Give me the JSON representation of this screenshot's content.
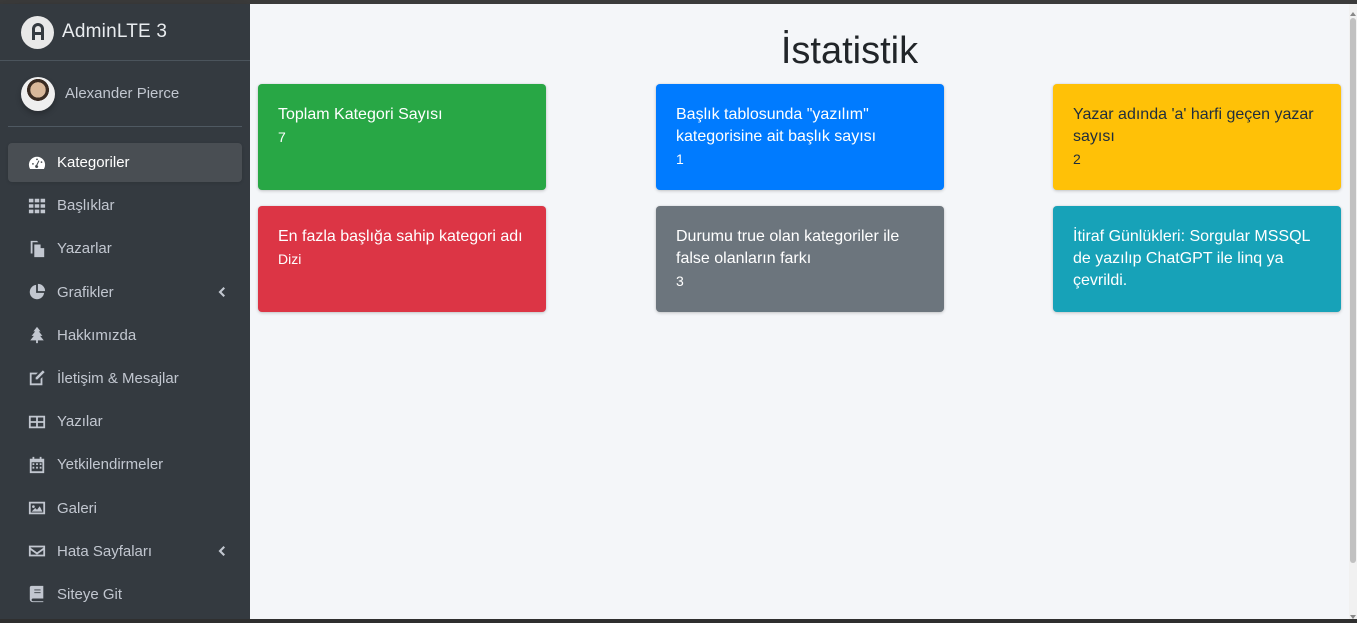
{
  "brand": {
    "name": "AdminLTE 3"
  },
  "user": {
    "name": "Alexander Pierce"
  },
  "sidebar": {
    "items": [
      {
        "label": "Kategoriler",
        "icon": "tachometer-icon",
        "active": true
      },
      {
        "label": "Başlıklar",
        "icon": "grid-icon"
      },
      {
        "label": "Yazarlar",
        "icon": "copy-icon"
      },
      {
        "label": "Grafikler",
        "icon": "pie-chart-icon",
        "has_caret": true
      },
      {
        "label": "Hakkımızda",
        "icon": "tree-icon"
      },
      {
        "label": "İletişim & Mesajlar",
        "icon": "edit-icon"
      },
      {
        "label": "Yazılar",
        "icon": "table-icon"
      },
      {
        "label": "Yetkilendirmeler",
        "icon": "calendar-icon"
      },
      {
        "label": "Galeri",
        "icon": "image-icon"
      },
      {
        "label": "Hata Sayfaları",
        "icon": "envelope-icon",
        "has_caret": true
      },
      {
        "label": "Siteye Git",
        "icon": "book-icon"
      }
    ]
  },
  "main": {
    "title": "İstatistik",
    "cards": [
      {
        "title": "Toplam Kategori Sayısı",
        "value": "7",
        "color": "#28a745"
      },
      {
        "title": "Başlık tablosunda \"yazılım\" kategorisine ait başlık sayısı",
        "value": "1",
        "color": "#007bff"
      },
      {
        "title": "Yazar adında 'a' harfi geçen yazar sayısı",
        "value": "2",
        "color": "#ffc107"
      },
      {
        "title": "En fazla başlığa sahip kategori adı",
        "value": "Dizi",
        "color": "#dc3545"
      },
      {
        "title": "Durumu true olan kategoriler ile false olanların farkı",
        "value": "3",
        "color": "#6c757d"
      },
      {
        "title": "İtiraf Günlükleri: Sorgular MSSQL de yazılıp ChatGPT ile linq ya çevrildi.",
        "value": "",
        "color": "#17a2b8"
      }
    ]
  }
}
